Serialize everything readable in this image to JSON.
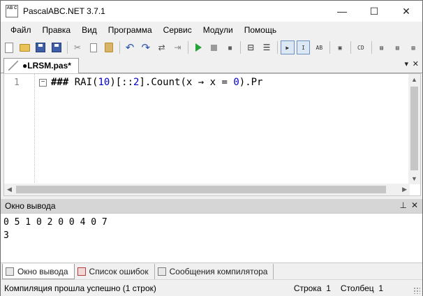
{
  "window": {
    "title": "PascalABC.NET 3.7.1",
    "app_icon_text": "AB C",
    "controls": {
      "minimize": "—",
      "maximize": "☐",
      "close": "✕"
    }
  },
  "menu": [
    "Файл",
    "Правка",
    "Вид",
    "Программа",
    "Сервис",
    "Модули",
    "Помощь"
  ],
  "toolbar": {
    "icons": [
      "new-file-icon",
      "open-folder-icon",
      "save-icon",
      "save-all-icon",
      "cut-icon",
      "copy-icon",
      "paste-icon",
      "undo-icon",
      "redo-icon",
      "find-icon",
      "replace-icon",
      "run-icon",
      "stop-icon",
      "step-icon",
      "debug-icon",
      "output-icon",
      "console-icon",
      "format-icon",
      "compile-icon",
      "code-icon",
      "help-icon"
    ]
  },
  "tabs": {
    "active_tab": "●LRSM.pas*",
    "dropdown": "▾",
    "close": "✕"
  },
  "editor": {
    "line_number": "1",
    "fold_marker": "−",
    "code_parts": {
      "hash": "###",
      "p1": " RAI(",
      "n1": "10",
      "p2": ")[::",
      "n2": "2",
      "p3": "].Count(x → x = ",
      "n3": "0",
      "p4": ").Pr"
    }
  },
  "output": {
    "title": "Окно вывода",
    "pin": "⊥",
    "close": "✕",
    "lines": [
      "0 5 1 0 2 0 0 4 0 7",
      "3"
    ]
  },
  "bottom_tabs": [
    "Окно вывода",
    "Список ошибок",
    "Сообщения компилятора"
  ],
  "status": {
    "message": "Компиляция прошла успешно (1 строк)",
    "row_label": "Строка",
    "row_value": "1",
    "col_label": "Столбец",
    "col_value": "1"
  }
}
